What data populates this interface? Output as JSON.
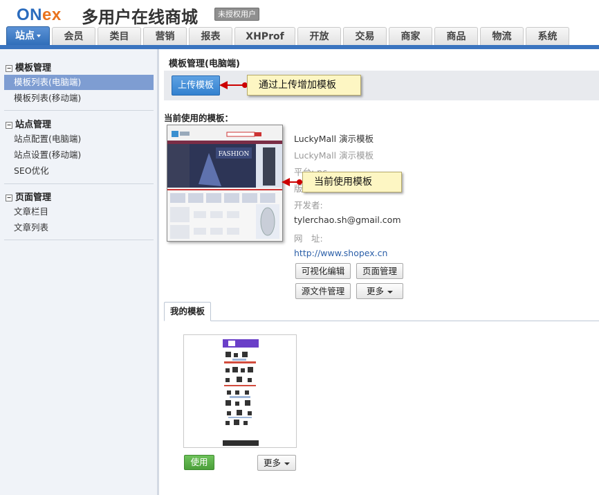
{
  "header": {
    "logo_part1": "ON",
    "logo_part2": "ex",
    "site_name": "多用户在线商城",
    "license_badge": "未授权用户"
  },
  "nav": {
    "tabs": [
      "站点",
      "会员",
      "类目",
      "营销",
      "报表",
      "XHProf",
      "开放",
      "交易",
      "商家",
      "商品",
      "物流",
      "系统"
    ],
    "active": "站点"
  },
  "sidebar": {
    "groups": [
      {
        "title": "模板管理",
        "items": [
          "模板列表(电脑端)",
          "模板列表(移动端)"
        ]
      },
      {
        "title": "站点管理",
        "items": [
          "站点配置(电脑端)",
          "站点设置(移动端)",
          "SEO优化"
        ]
      },
      {
        "title": "页面管理",
        "items": [
          "文章栏目",
          "文章列表"
        ]
      }
    ],
    "active_item": "模板列表(电脑端)"
  },
  "main": {
    "title": "模板管理(电脑端)",
    "upload_button": "上传模板",
    "upload_callout": "通过上传增加模板",
    "current_label": "当前使用的模板：",
    "current_callout": "当前使用模板",
    "thumb_banner_text": "FASHION",
    "template": {
      "name": "LuckyMall 演示模板",
      "name_sub": "LuckyMall 演示模板",
      "platform": "平台: pc",
      "version": "版本",
      "developer": "开发者:",
      "email": "tylerchao.sh@gmail.com",
      "site_label": "网　址:",
      "url": "http://www.shopex.cn"
    },
    "buttons": {
      "visual_edit": "可视化编辑",
      "page_manage": "页面管理",
      "source_manage": "源文件管理",
      "more": "更多"
    },
    "my_templates_tab": "我的模板",
    "use_button": "使用",
    "card_more_button": "更多"
  },
  "colors": {
    "nav_active": "#3a74bf",
    "sidebar_bg": "#f0f3f8",
    "sidebar_active": "#7e9dd2",
    "callout_bg": "#fdf6c3",
    "arrow": "#cc0000",
    "use_button": "#4b9f3a"
  }
}
